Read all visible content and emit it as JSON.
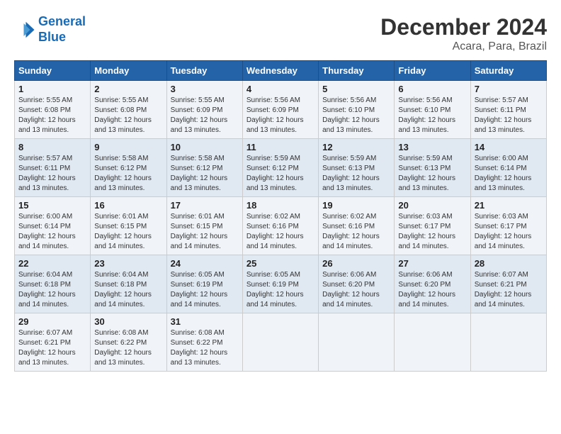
{
  "header": {
    "logo_line1": "General",
    "logo_line2": "Blue",
    "month_title": "December 2024",
    "location": "Acara, Para, Brazil"
  },
  "weekdays": [
    "Sunday",
    "Monday",
    "Tuesday",
    "Wednesday",
    "Thursday",
    "Friday",
    "Saturday"
  ],
  "weeks": [
    [
      {
        "day": "1",
        "sunrise": "5:55 AM",
        "sunset": "6:08 PM",
        "daylight": "12 hours and 13 minutes."
      },
      {
        "day": "2",
        "sunrise": "5:55 AM",
        "sunset": "6:08 PM",
        "daylight": "12 hours and 13 minutes."
      },
      {
        "day": "3",
        "sunrise": "5:55 AM",
        "sunset": "6:09 PM",
        "daylight": "12 hours and 13 minutes."
      },
      {
        "day": "4",
        "sunrise": "5:56 AM",
        "sunset": "6:09 PM",
        "daylight": "12 hours and 13 minutes."
      },
      {
        "day": "5",
        "sunrise": "5:56 AM",
        "sunset": "6:10 PM",
        "daylight": "12 hours and 13 minutes."
      },
      {
        "day": "6",
        "sunrise": "5:56 AM",
        "sunset": "6:10 PM",
        "daylight": "12 hours and 13 minutes."
      },
      {
        "day": "7",
        "sunrise": "5:57 AM",
        "sunset": "6:11 PM",
        "daylight": "12 hours and 13 minutes."
      }
    ],
    [
      {
        "day": "8",
        "sunrise": "5:57 AM",
        "sunset": "6:11 PM",
        "daylight": "12 hours and 13 minutes."
      },
      {
        "day": "9",
        "sunrise": "5:58 AM",
        "sunset": "6:12 PM",
        "daylight": "12 hours and 13 minutes."
      },
      {
        "day": "10",
        "sunrise": "5:58 AM",
        "sunset": "6:12 PM",
        "daylight": "12 hours and 13 minutes."
      },
      {
        "day": "11",
        "sunrise": "5:59 AM",
        "sunset": "6:12 PM",
        "daylight": "12 hours and 13 minutes."
      },
      {
        "day": "12",
        "sunrise": "5:59 AM",
        "sunset": "6:13 PM",
        "daylight": "12 hours and 13 minutes."
      },
      {
        "day": "13",
        "sunrise": "5:59 AM",
        "sunset": "6:13 PM",
        "daylight": "12 hours and 13 minutes."
      },
      {
        "day": "14",
        "sunrise": "6:00 AM",
        "sunset": "6:14 PM",
        "daylight": "12 hours and 13 minutes."
      }
    ],
    [
      {
        "day": "15",
        "sunrise": "6:00 AM",
        "sunset": "6:14 PM",
        "daylight": "12 hours and 14 minutes."
      },
      {
        "day": "16",
        "sunrise": "6:01 AM",
        "sunset": "6:15 PM",
        "daylight": "12 hours and 14 minutes."
      },
      {
        "day": "17",
        "sunrise": "6:01 AM",
        "sunset": "6:15 PM",
        "daylight": "12 hours and 14 minutes."
      },
      {
        "day": "18",
        "sunrise": "6:02 AM",
        "sunset": "6:16 PM",
        "daylight": "12 hours and 14 minutes."
      },
      {
        "day": "19",
        "sunrise": "6:02 AM",
        "sunset": "6:16 PM",
        "daylight": "12 hours and 14 minutes."
      },
      {
        "day": "20",
        "sunrise": "6:03 AM",
        "sunset": "6:17 PM",
        "daylight": "12 hours and 14 minutes."
      },
      {
        "day": "21",
        "sunrise": "6:03 AM",
        "sunset": "6:17 PM",
        "daylight": "12 hours and 14 minutes."
      }
    ],
    [
      {
        "day": "22",
        "sunrise": "6:04 AM",
        "sunset": "6:18 PM",
        "daylight": "12 hours and 14 minutes."
      },
      {
        "day": "23",
        "sunrise": "6:04 AM",
        "sunset": "6:18 PM",
        "daylight": "12 hours and 14 minutes."
      },
      {
        "day": "24",
        "sunrise": "6:05 AM",
        "sunset": "6:19 PM",
        "daylight": "12 hours and 14 minutes."
      },
      {
        "day": "25",
        "sunrise": "6:05 AM",
        "sunset": "6:19 PM",
        "daylight": "12 hours and 14 minutes."
      },
      {
        "day": "26",
        "sunrise": "6:06 AM",
        "sunset": "6:20 PM",
        "daylight": "12 hours and 14 minutes."
      },
      {
        "day": "27",
        "sunrise": "6:06 AM",
        "sunset": "6:20 PM",
        "daylight": "12 hours and 14 minutes."
      },
      {
        "day": "28",
        "sunrise": "6:07 AM",
        "sunset": "6:21 PM",
        "daylight": "12 hours and 14 minutes."
      }
    ],
    [
      {
        "day": "29",
        "sunrise": "6:07 AM",
        "sunset": "6:21 PM",
        "daylight": "12 hours and 13 minutes."
      },
      {
        "day": "30",
        "sunrise": "6:08 AM",
        "sunset": "6:22 PM",
        "daylight": "12 hours and 13 minutes."
      },
      {
        "day": "31",
        "sunrise": "6:08 AM",
        "sunset": "6:22 PM",
        "daylight": "12 hours and 13 minutes."
      },
      null,
      null,
      null,
      null
    ]
  ],
  "labels": {
    "sunrise_prefix": "Sunrise: ",
    "sunset_prefix": "Sunset: ",
    "daylight_prefix": "Daylight: "
  }
}
